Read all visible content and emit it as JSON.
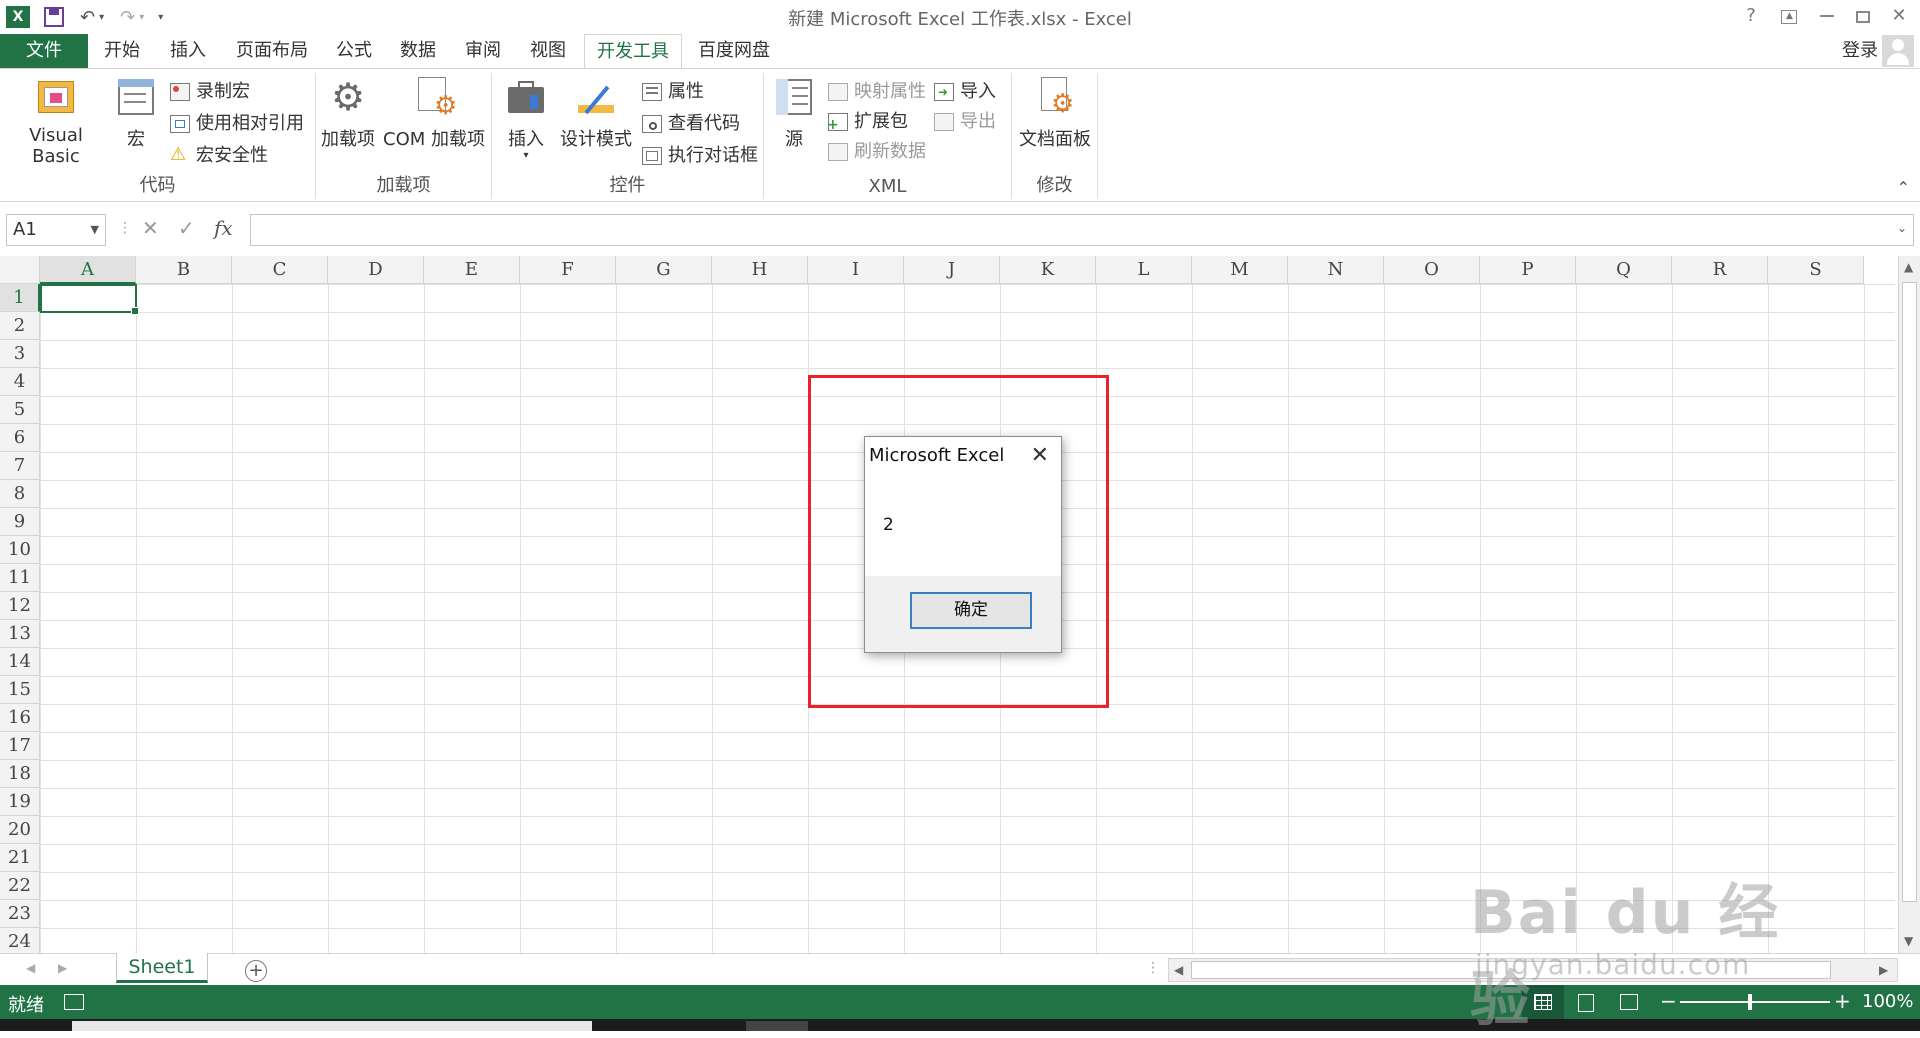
{
  "window": {
    "title": "新建 Microsoft Excel 工作表.xlsx - Excel",
    "help": "?",
    "controls": [
      "restore-ribbon",
      "minimize",
      "maximize",
      "close"
    ]
  },
  "tabs": {
    "file": "文件",
    "items": [
      "开始",
      "插入",
      "页面布局",
      "公式",
      "数据",
      "审阅",
      "视图",
      "开发工具",
      "百度网盘"
    ],
    "active": "开发工具",
    "login": "登录"
  },
  "ribbon": {
    "code": {
      "label": "代码",
      "visual_basic": "Visual Basic",
      "macros": "宏",
      "record_macro": "录制宏",
      "relative_ref": "使用相对引用",
      "macro_security": "宏安全性"
    },
    "addins": {
      "label": "加载项",
      "addins": "加载项",
      "com_addins": "COM 加载项"
    },
    "controls": {
      "label": "控件",
      "insert": "插入",
      "design_mode": "设计模式",
      "properties": "属性",
      "view_code": "查看代码",
      "run_dialog": "执行对话框"
    },
    "xml": {
      "label": "XML",
      "source": "源",
      "map_properties": "映射属性",
      "expansion_packs": "扩展包",
      "refresh_data": "刷新数据",
      "import": "导入",
      "export": "导出"
    },
    "modify": {
      "label": "修改",
      "document_panel": "文档面板"
    }
  },
  "formula_bar": {
    "name_box": "A1",
    "fx": "fx",
    "value": ""
  },
  "grid": {
    "columns": [
      "A",
      "B",
      "C",
      "D",
      "E",
      "F",
      "G",
      "H",
      "I",
      "J",
      "K",
      "L",
      "M",
      "N",
      "O",
      "P",
      "Q",
      "R",
      "S"
    ],
    "rows": [
      "1",
      "2",
      "3",
      "4",
      "5",
      "6",
      "7",
      "8",
      "9",
      "10",
      "11",
      "12",
      "13",
      "14",
      "15",
      "16",
      "17",
      "18",
      "19",
      "20",
      "21",
      "22",
      "23",
      "24"
    ],
    "active_cell": "A1"
  },
  "sheets": {
    "tabs": [
      "Sheet1"
    ],
    "add": "+"
  },
  "status": {
    "ready": "就绪",
    "zoom": "100%",
    "zoom_minus": "−",
    "zoom_plus": "+"
  },
  "dialog": {
    "title": "Microsoft Excel",
    "message": "2",
    "ok": "确定"
  },
  "watermark": {
    "brand": "Bai du 经验",
    "url": "jingyan.baidu.com"
  },
  "colors": {
    "excel_green": "#217346",
    "highlight_red": "#e8232a",
    "button_blue": "#3c7fc1"
  }
}
